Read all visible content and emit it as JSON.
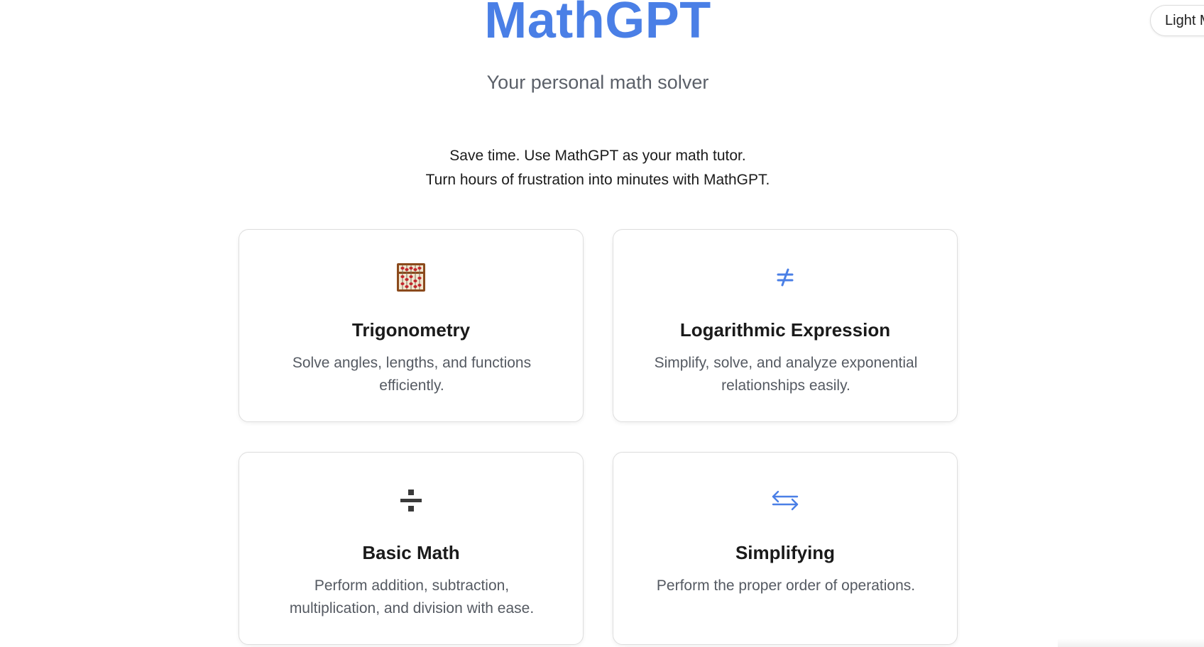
{
  "header": {
    "title": "MathGPT",
    "subtitle": "Your personal math solver",
    "tagline_line1": "Save time. Use MathGPT as your math tutor.",
    "tagline_line2": "Turn hours of frustration into minutes with MathGPT.",
    "theme_toggle_label": "Light Mode"
  },
  "colors": {
    "brand": "#4a7fe6",
    "text": "#1a1a1a",
    "muted": "#555a62",
    "card_border": "#dedede"
  },
  "cards": [
    {
      "icon": "abacus-icon",
      "title": "Trigonometry",
      "description": "Solve angles, lengths, and functions efficiently."
    },
    {
      "icon": "not-equal-icon",
      "title": "Logarithmic Expression",
      "description": "Simplify, solve, and analyze exponential relationships easily."
    },
    {
      "icon": "division-icon",
      "title": "Basic Math",
      "description": "Perform addition, subtraction, multiplication, and division with ease."
    },
    {
      "icon": "swap-arrows-icon",
      "title": "Simplifying",
      "description": "Perform the proper order of operations."
    }
  ]
}
